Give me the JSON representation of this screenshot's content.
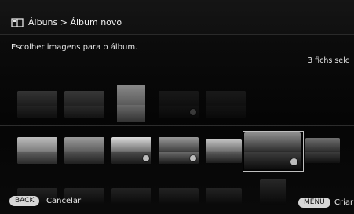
{
  "header": {
    "breadcrumb": "Álbuns > Álbum novo"
  },
  "main": {
    "instruction": "Escolher imagens para o álbum.",
    "selected_count": "3 fichs selc"
  },
  "footer": {
    "back_button": "BACK",
    "back_label": "Cancelar",
    "menu_button": "MENU",
    "menu_label": "Criar"
  },
  "colors": {
    "background": "#000000",
    "text": "#e9e9e9",
    "button_bg": "#d7d7d7"
  },
  "icons": {
    "album": "album-icon",
    "selected": "check-badge-icon"
  }
}
